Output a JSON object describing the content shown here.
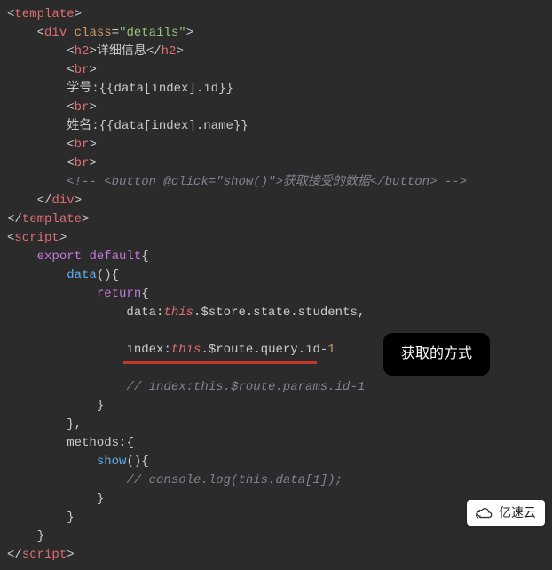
{
  "code": {
    "l1": {
      "tag": "template"
    },
    "l2": {
      "tag": "div",
      "attr": "class",
      "val": "\"details\""
    },
    "l3": {
      "tag": "h2",
      "text": "详细信息"
    },
    "l4": {
      "tag": "br"
    },
    "l5": {
      "text": "学号:",
      "expr_open": "{{",
      "expr_close": "}}",
      "prop1": "data",
      "idx": "index",
      "prop2": "id"
    },
    "l6": {
      "tag": "br"
    },
    "l7": {
      "text": "姓名:",
      "expr_open": "{{",
      "expr_close": "}}",
      "prop1": "data",
      "idx": "index",
      "prop2": "name"
    },
    "l8": {
      "tag": "br"
    },
    "l9": {
      "tag": "br"
    },
    "l10": {
      "comment": "<!-- <button @click=\"show()\">获取接受的数据</button> -->"
    },
    "l11": {
      "tag": "div"
    },
    "l12": {
      "tag": "template"
    },
    "l13": {
      "tag": "script"
    },
    "l14": {
      "kw1": "export",
      "kw2": "default",
      "brace": "{"
    },
    "l15": {
      "func": "data",
      "paren": "()",
      "brace": "{"
    },
    "l16": {
      "kw": "return",
      "brace": "{"
    },
    "l17": {
      "key": "data",
      "this": "this",
      "chain": ".$store.state.students,"
    },
    "l18": {
      "blank": ""
    },
    "l19": {
      "key": "index",
      "this": "this",
      "chain": ".$route.query.id",
      "minus": "-",
      "num": "1"
    },
    "l20": {
      "blank": ""
    },
    "l21": {
      "comment": "// index:this.$route.params.id-1"
    },
    "l22": {
      "brace": "}"
    },
    "l23": {
      "brace": "},"
    },
    "l24": {
      "key": "methods",
      "colon": ":",
      "brace": "{"
    },
    "l25": {
      "func": "show",
      "paren": "()",
      "brace": "{"
    },
    "l26": {
      "comment": "// console.log(this.data[1]);"
    },
    "l27": {
      "brace": "}"
    },
    "l28": {
      "brace": "}"
    },
    "l29": {
      "brace": "}"
    },
    "l30": {
      "tag": "script"
    }
  },
  "callout": {
    "text": "获取的方式"
  },
  "watermark": {
    "text": "亿速云"
  }
}
